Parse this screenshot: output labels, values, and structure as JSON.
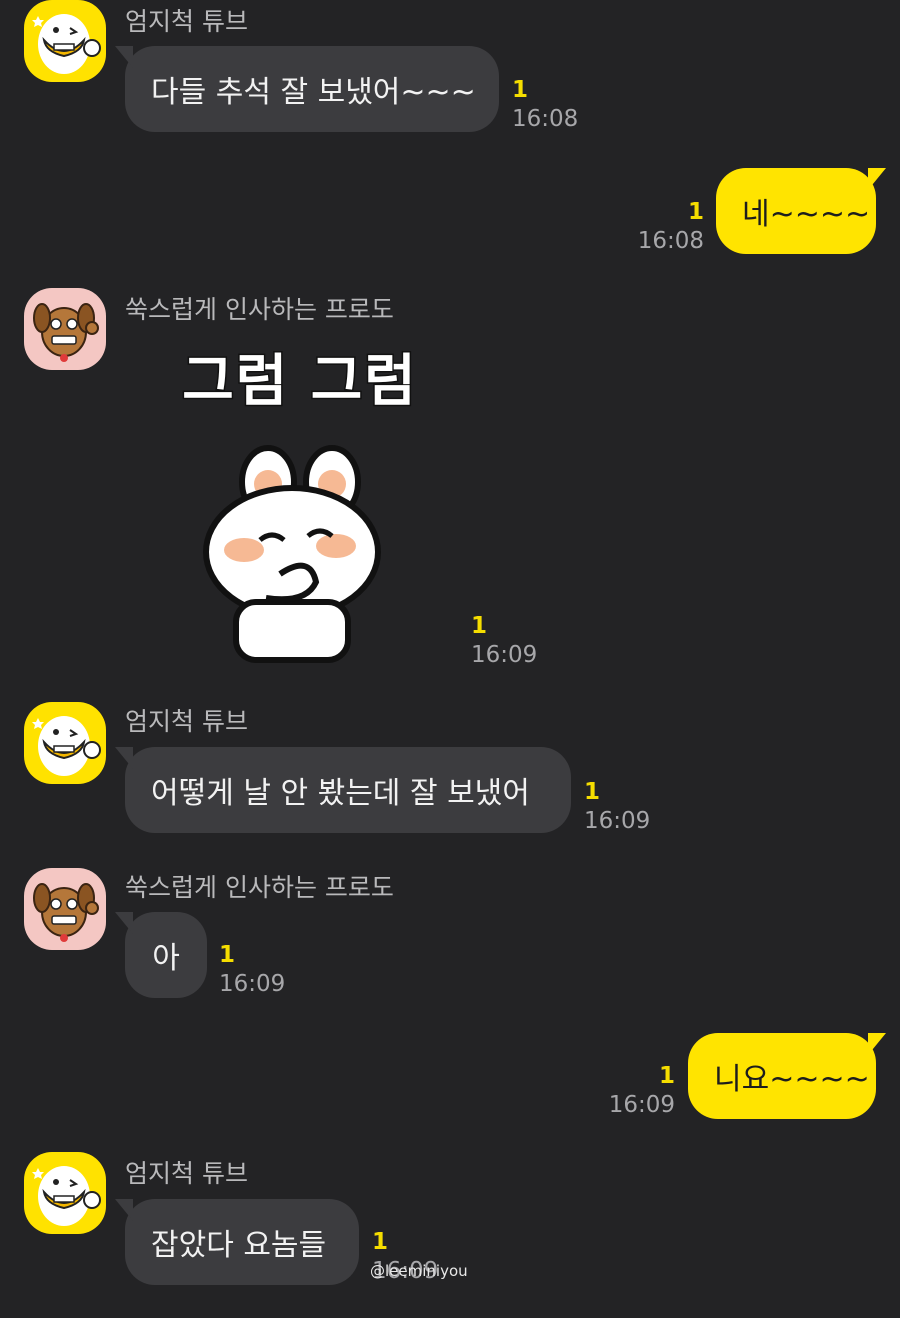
{
  "chat": {
    "messages": [
      {
        "sender": "엄지척 튜브",
        "text": "다들 추석 잘 보냈어~~~",
        "unread": "1",
        "time": "16:08"
      },
      {
        "text": "네~~~~",
        "unread": "1",
        "time": "16:08"
      },
      {
        "sender": "쑥스럽게 인사하는 프로도",
        "sticker_text": "그럼 그럼",
        "unread": "1",
        "time": "16:09"
      },
      {
        "sender": "엄지척 튜브",
        "text": "어떻게 날 안 봤는데 잘 보냈어",
        "unread": "1",
        "time": "16:09"
      },
      {
        "sender": "쑥스럽게 인사하는 프로도",
        "text": "아",
        "unread": "1",
        "time": "16:09"
      },
      {
        "text": "니요~~~~",
        "unread": "1",
        "time": "16:09"
      },
      {
        "sender": "엄지척 튜브",
        "text": "잡았다 요놈들",
        "unread": "1",
        "time": "16:09"
      }
    ]
  },
  "watermark": "@leeminiyou",
  "colors": {
    "background": "#232325",
    "incoming_bubble": "#3c3c3f",
    "outgoing_bubble": "#ffe400",
    "unread": "#f5dd00"
  },
  "icons": {
    "tube_avatar": "tube-avatar-icon",
    "frodo_avatar": "frodo-avatar-icon",
    "sticker": "bunny-sticker"
  }
}
